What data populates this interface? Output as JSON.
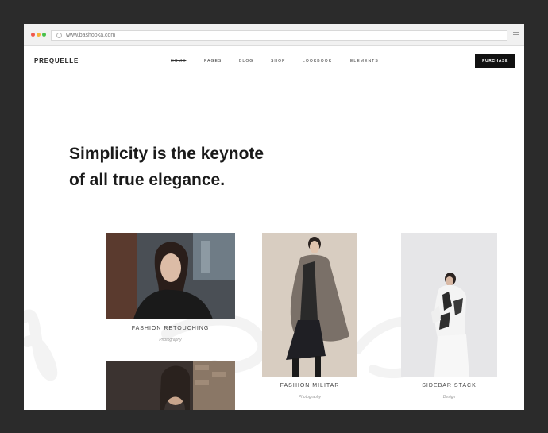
{
  "browser": {
    "url": "www.bashooka.com"
  },
  "site": {
    "logo": "PREQUELLE",
    "nav": [
      "HOME",
      "PAGES",
      "BLOG",
      "SHOP",
      "LOOKBOOK",
      "ELEMENTS"
    ],
    "purchase_label": "PURCHASE"
  },
  "hero": {
    "line1": "Simplicity is the keynote",
    "line2": "of all true elegance."
  },
  "portfolio": [
    {
      "title": "FASHION RETOUCHING",
      "category": "Photography"
    },
    {
      "title": "FASHION MILITAR",
      "category": "Photography"
    },
    {
      "title": "SIDEBAR STACK",
      "category": "Design"
    }
  ],
  "colors": {
    "background": "#2b2b2b",
    "page": "#ffffff",
    "accent": "#111111"
  }
}
